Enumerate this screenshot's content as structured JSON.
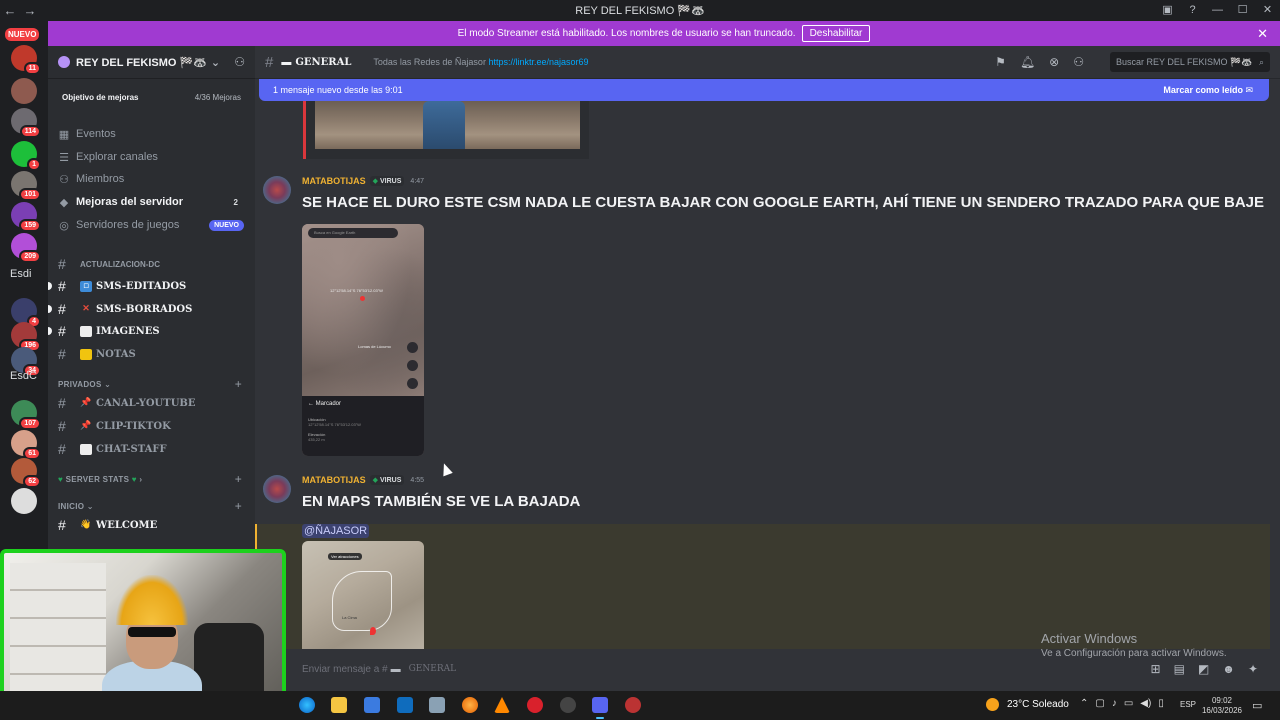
{
  "window": {
    "title": "REY DEL FEKISMO 🏁🦝"
  },
  "rail": {
    "nuevo_label": "NUEVO",
    "servers": [
      {
        "badge": "11",
        "color": "#c0392b"
      },
      {
        "badge": "",
        "color": "#8e5a4f"
      },
      {
        "badge": "114",
        "color": "#6d6a70"
      },
      {
        "badge": "1",
        "color": "#1dbf3a"
      },
      {
        "badge": "101",
        "color": "#7a7570"
      },
      {
        "badge": "159",
        "color": "#7b3fb4"
      },
      {
        "badge": "209",
        "color": "#b24fd8"
      },
      {
        "badge": "4",
        "color": "#3a3f6b"
      },
      {
        "badge": "196",
        "color": "#a33a3a"
      },
      {
        "badge": "34",
        "color": "#4a5a7a"
      },
      {
        "badge": "107",
        "color": "#3d8b57"
      },
      {
        "badge": "61",
        "color": "#d7a08a"
      },
      {
        "badge": "62",
        "color": "#b35a3a"
      },
      {
        "badge": "",
        "color": "#ddd"
      }
    ],
    "text1": "Esdi",
    "text2": "EsdC"
  },
  "banner": {
    "text": "El modo Streamer está habilitado. Los nombres de usuario se han truncado.",
    "button": "Deshabilitar"
  },
  "sidebar": {
    "server_name": "REY DEL FEKISMO 🏁🦝",
    "boost_label": "Objetivo de mejoras",
    "boost_progress": "4/36 Mejoras",
    "nav": {
      "events": "Eventos",
      "explore": "Explorar canales",
      "members": "Miembros",
      "boosts": "Mejoras del servidor",
      "boosts_count": "2",
      "game_servers": "Servidores de juegos",
      "game_badge": "NUEVO"
    },
    "channels": {
      "actualizacion": "ACTUALIZACION-DC",
      "sms_editados": "SMS-EDITADOS",
      "sms_borrados": "SMS-BORRADOS",
      "imagenes": "IMAGENES",
      "notas": "NOTAS",
      "cat_privados": "PRIVADOS",
      "canal_youtube": "CANAL-YOUTUBE",
      "clip_tiktok": "CLIP-TIKTOK",
      "chat_staff": "CHAT-STAFF",
      "cat_stats": "SERVER STATS",
      "cat_inicio": "INICIO",
      "welcome": "WELCOME"
    }
  },
  "header": {
    "channel": "GENERAL",
    "topic": "Todas las Redes de Ñajasor",
    "topic_link": "https://linktr.ee/najasor69",
    "search_placeholder": "Buscar REY DEL FEKISMO 🏁🦝"
  },
  "newbar": {
    "text": "1 mensaje nuevo desde las 9:01",
    "mark": "Marcar como leído"
  },
  "messages": [
    {
      "author": "MATABOTIJAS",
      "tag": "VIRUS",
      "time": "4:47",
      "content": "SE HACE EL DURO ESTE CSM NADA LE CUESTA BAJAR CON GOOGLE EARTH, AHÍ TIENE UN SENDERO TRAZADO PARA QUE BAJE",
      "image": {
        "search": "Busca en Google Earth",
        "coords": "12°12'58.14\"S 76°53'12.03\"W",
        "place": "Lomas de Lúcumo",
        "marker_title": "Marcador",
        "location_label": "Ubicación",
        "location_value": "12°12'58.14\"S 76°53'12.03\"W",
        "elevation_label": "Elevación",
        "elevation_value": "435,22 m"
      }
    },
    {
      "author": "MATABOTIJAS",
      "tag": "VIRUS",
      "time": "4:55",
      "content": "EN MAPS TAMBIÉN SE VE LA BAJADA",
      "mention": "@ÑAJASOR",
      "image": {
        "label": "Ver atracciones",
        "place": "La Cima"
      }
    }
  ],
  "composer": {
    "placeholder": "Enviar mensaje a #",
    "channel": "GENERAL"
  },
  "watermark": {
    "line1": "Activar Windows",
    "line2": "Ve a Configuración para activar Windows."
  },
  "taskbar": {
    "weather": "23°C  Soleado",
    "lang": "ESP",
    "time": "09:02",
    "date": "16/03/2026"
  }
}
